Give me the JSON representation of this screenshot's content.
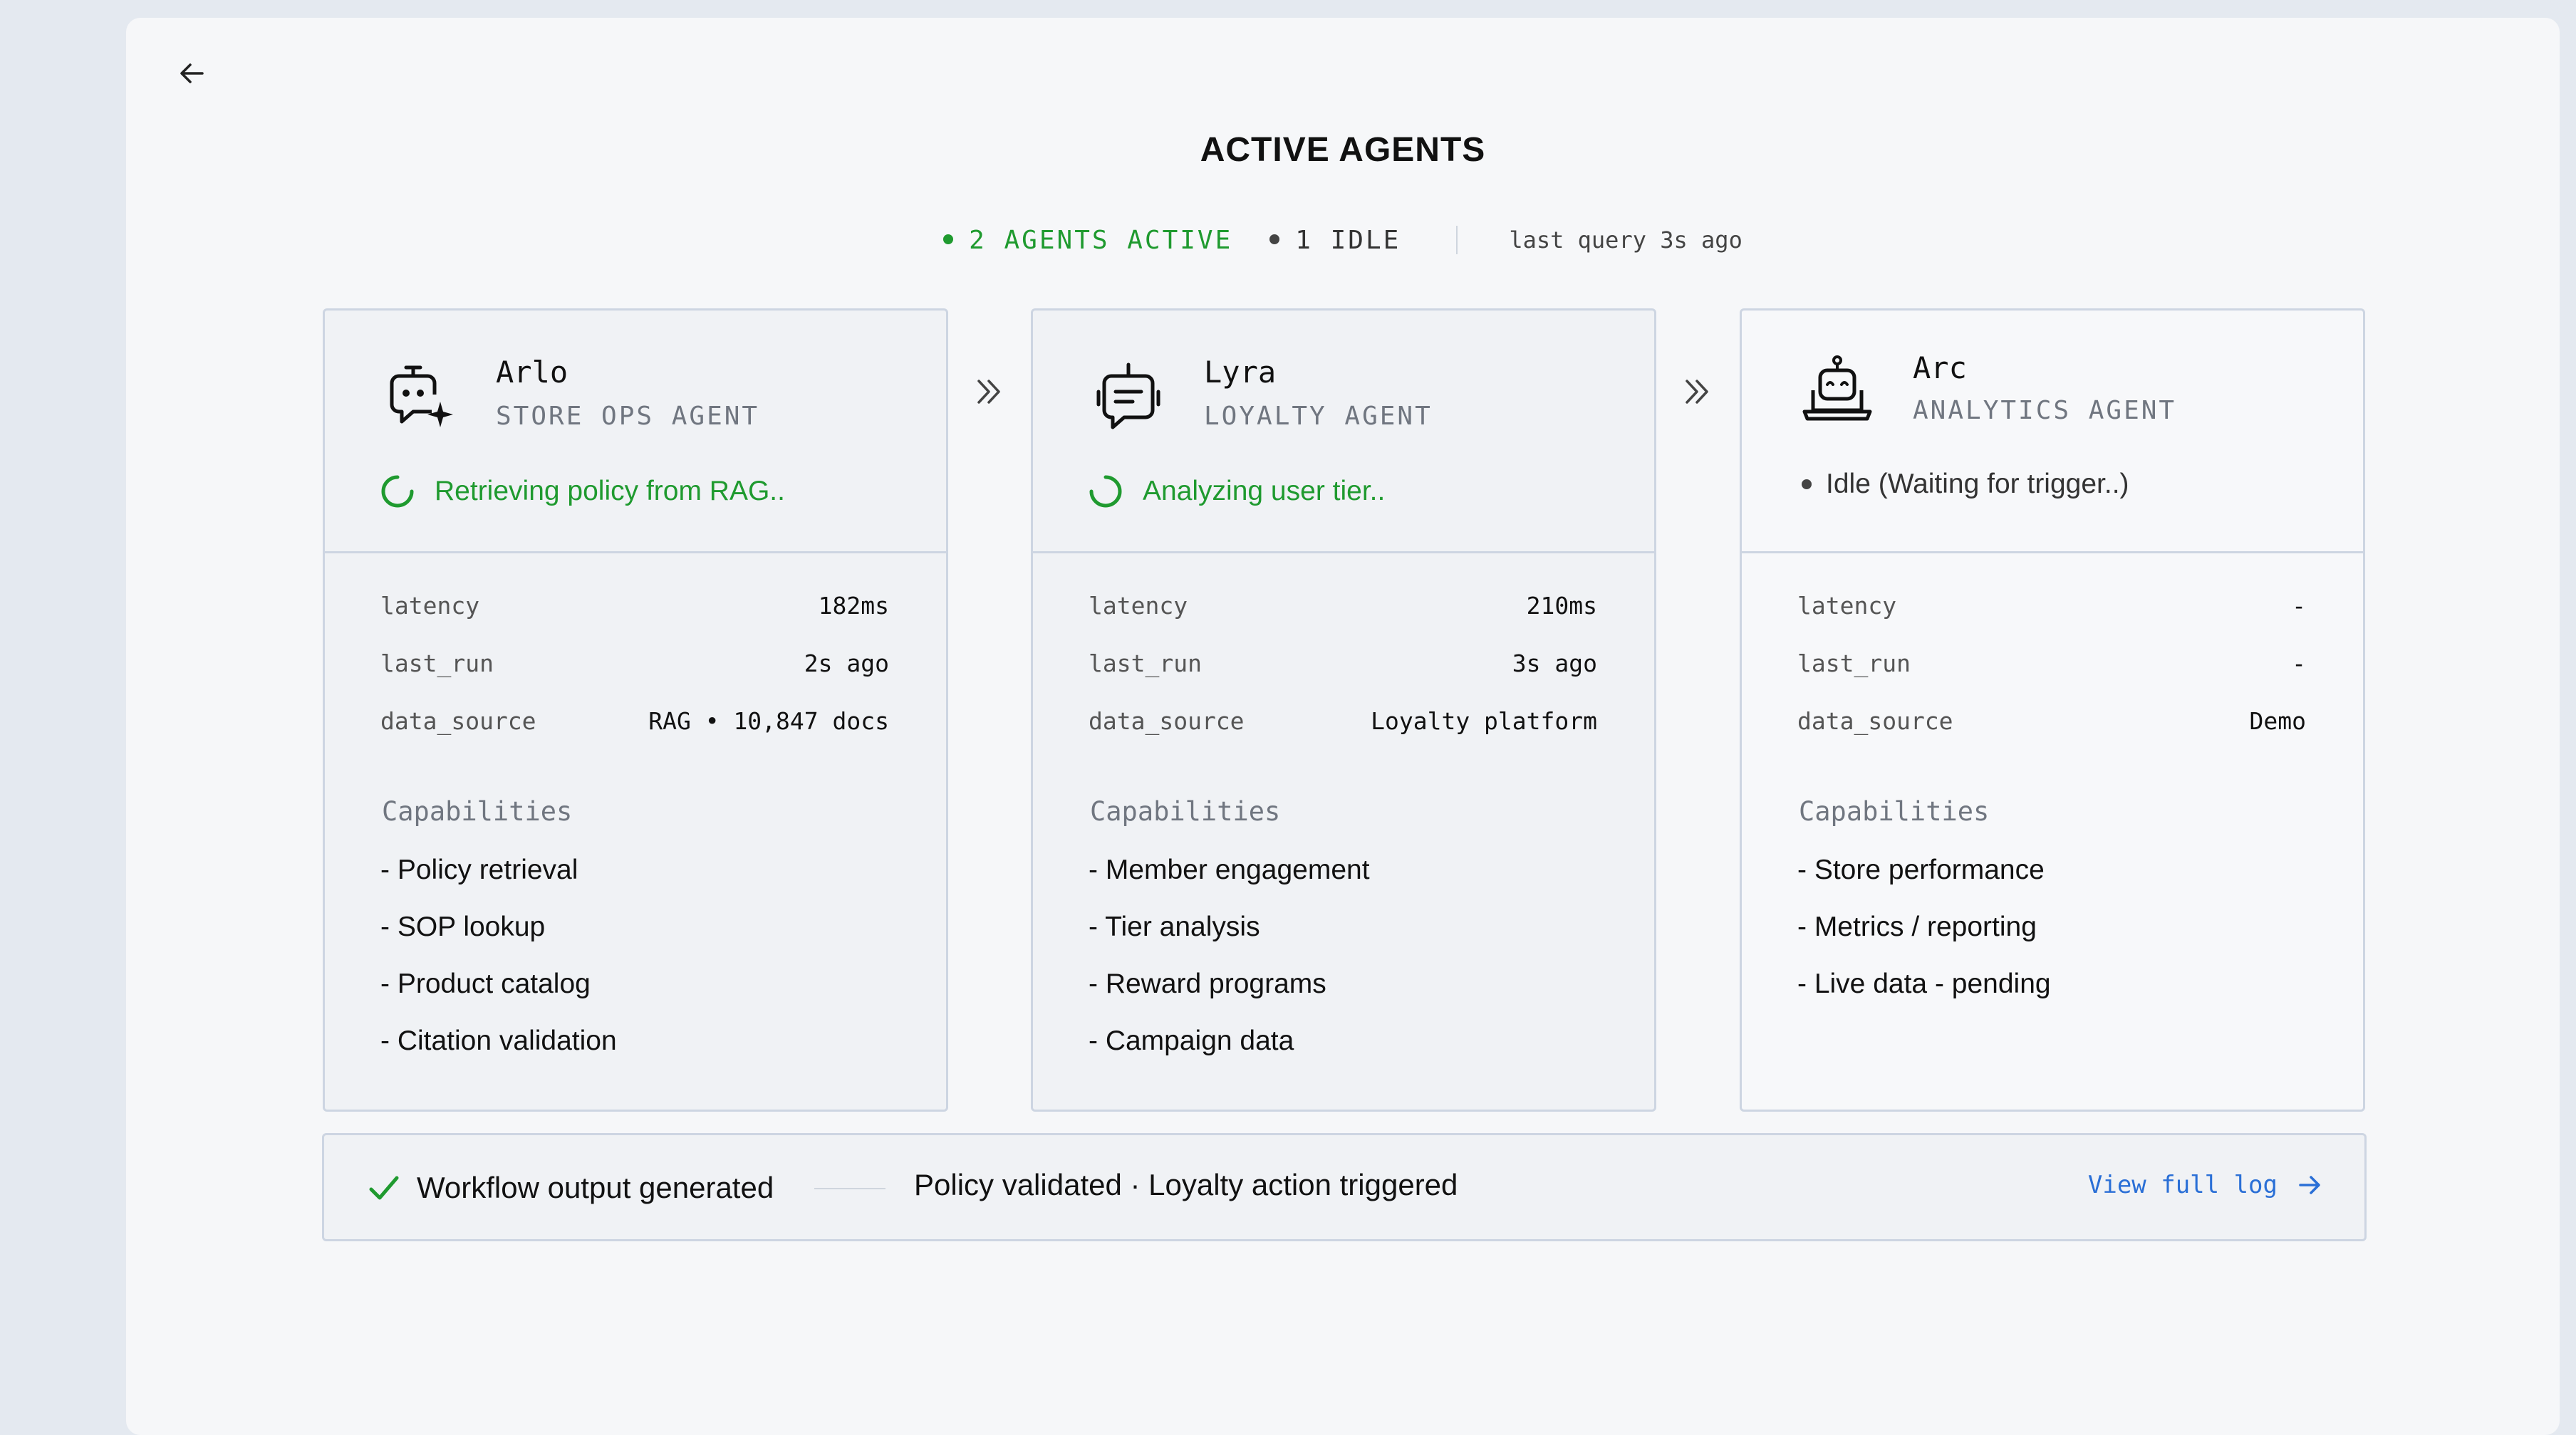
{
  "header": {
    "title": "ACTIVE AGENTS",
    "active_label": "2 AGENTS ACTIVE",
    "idle_label": "1 IDLE",
    "last_query": "last query 3s ago"
  },
  "agents": [
    {
      "name": "Arlo",
      "role": "STORE OPS AGENT",
      "status": "Retrieving policy from RAG..",
      "metrics": [
        {
          "key": "latency",
          "value": "182ms"
        },
        {
          "key": "last_run",
          "value": "2s ago"
        },
        {
          "key": "data_source",
          "value": "RAG • 10,847 docs"
        }
      ],
      "capabilities_title": "Capabilities",
      "capabilities": [
        "- Policy retrieval",
        "- SOP lookup",
        "- Product catalog",
        "- Citation validation"
      ]
    },
    {
      "name": "Lyra",
      "role": "LOYALTY AGENT",
      "status": "Analyzing user tier..",
      "metrics": [
        {
          "key": "latency",
          "value": "210ms"
        },
        {
          "key": "last_run",
          "value": "3s ago"
        },
        {
          "key": "data_source",
          "value": "Loyalty platform"
        }
      ],
      "capabilities_title": "Capabilities",
      "capabilities": [
        "- Member engagement",
        "- Tier analysis",
        "- Reward programs",
        "- Campaign data"
      ]
    },
    {
      "name": "Arc",
      "role": "ANALYTICS AGENT",
      "status": "Idle (Waiting for trigger..)",
      "metrics": [
        {
          "key": "latency",
          "value": "-"
        },
        {
          "key": "last_run",
          "value": "-"
        },
        {
          "key": "data_source",
          "value": "Demo"
        }
      ],
      "capabilities_title": "Capabilities",
      "capabilities": [
        "- Store performance",
        "- Metrics / reporting",
        "- Live data - pending"
      ]
    }
  ],
  "footer": {
    "done_label": "Workflow output generated",
    "summary": "Policy validated · Loyalty action triggered",
    "link_label": "View full log"
  },
  "colors": {
    "active": "#1f9a2f",
    "link": "#2a6fd6",
    "border": "#cdd5e2"
  },
  "icons": {
    "back": "arrow-left-icon",
    "arlo": "robot-sparkle-icon",
    "lyra": "robot-chat-icon",
    "arc": "robot-laptop-icon",
    "flow": "chevron-double-right-icon",
    "check": "check-icon",
    "link": "arrow-right-icon"
  }
}
